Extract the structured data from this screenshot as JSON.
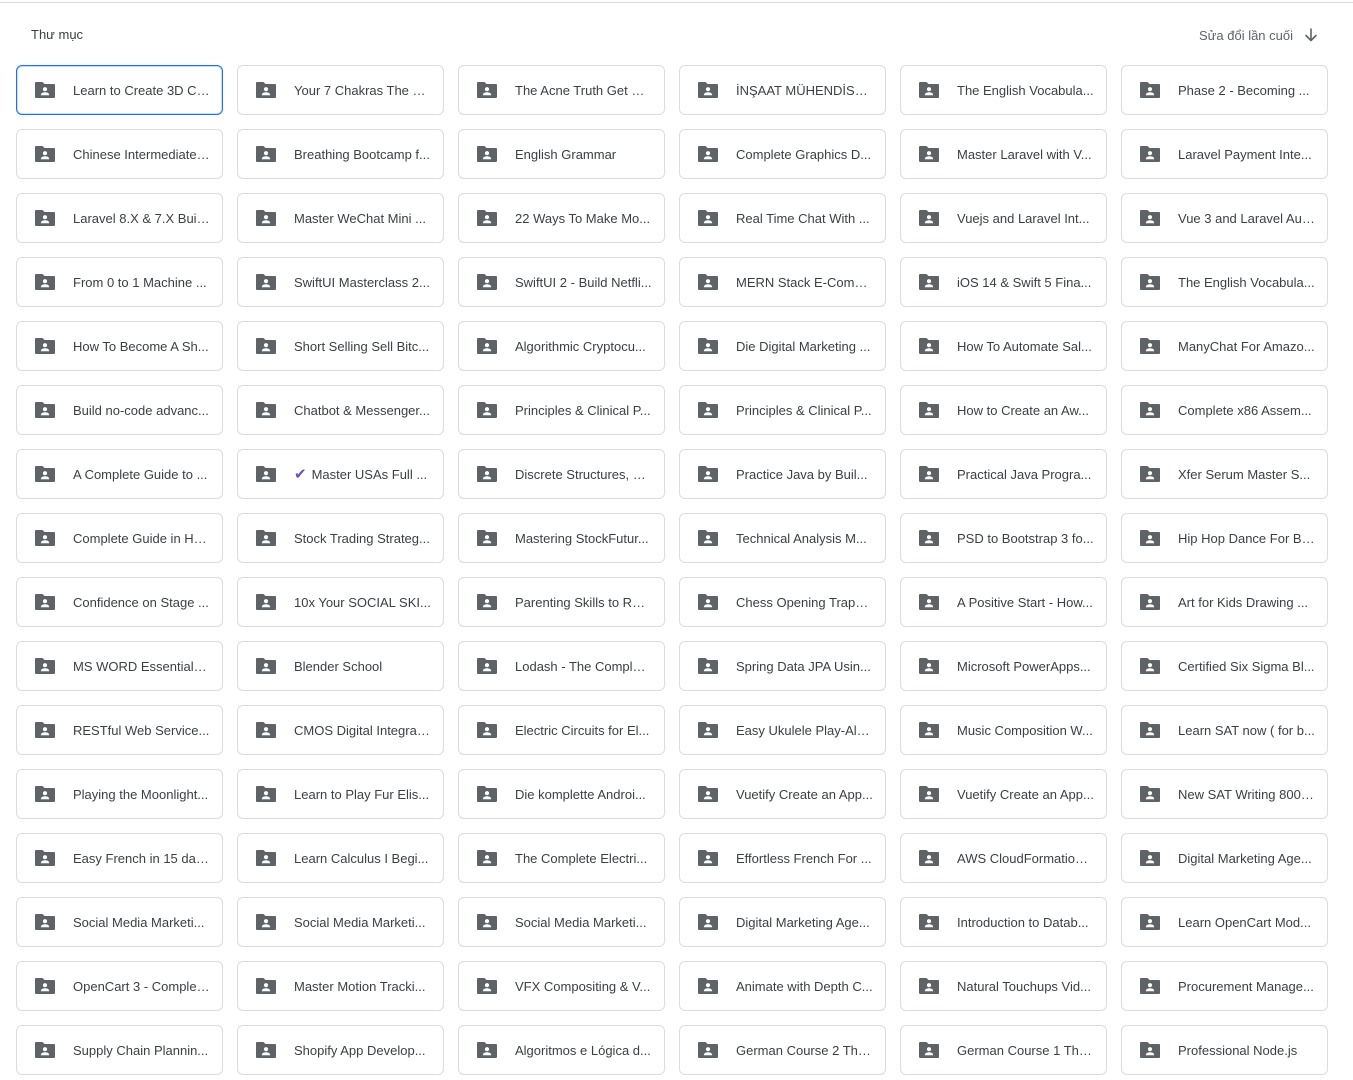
{
  "header": {
    "section_title": "Thư mục",
    "sort_label": "Sửa đổi lần cuối",
    "sort_icon": "arrow-down-icon"
  },
  "folder_icon": "shared-folder-icon",
  "folders": [
    {
      "name": "Learn to Create 3D Ch...",
      "selected": true
    },
    {
      "name": "Your 7 Chakras The C..."
    },
    {
      "name": "The Acne Truth Get Cl..."
    },
    {
      "name": "İNŞAAT MÜHENDİSLİ..."
    },
    {
      "name": "The English Vocabula..."
    },
    {
      "name": "Phase 2 - Becoming ..."
    },
    {
      "name": "Chinese Intermediate ..."
    },
    {
      "name": "Breathing Bootcamp f..."
    },
    {
      "name": "English Grammar"
    },
    {
      "name": "Complete Graphics D..."
    },
    {
      "name": "Master Laravel with V..."
    },
    {
      "name": "Laravel Payment Inte..."
    },
    {
      "name": "Laravel 8.X & 7.X Buil..."
    },
    {
      "name": "Master WeChat Mini ..."
    },
    {
      "name": "22 Ways To Make Mo..."
    },
    {
      "name": "Real Time Chat With ..."
    },
    {
      "name": "Vuejs and Laravel Int..."
    },
    {
      "name": "Vue 3 and Laravel Aut..."
    },
    {
      "name": "From 0 to 1 Machine ..."
    },
    {
      "name": "SwiftUI Masterclass 2..."
    },
    {
      "name": "SwiftUI 2 - Build Netfli..."
    },
    {
      "name": "MERN Stack E-Comm..."
    },
    {
      "name": "iOS 14 & Swift 5 Fina..."
    },
    {
      "name": "The English Vocabula..."
    },
    {
      "name": "How To Become A Sh..."
    },
    {
      "name": "Short Selling Sell Bitc..."
    },
    {
      "name": "Algorithmic Cryptocu..."
    },
    {
      "name": "Die Digital Marketing ..."
    },
    {
      "name": "How To Automate Sal..."
    },
    {
      "name": "ManyChat For Amazo..."
    },
    {
      "name": "Build no-code advanc..."
    },
    {
      "name": "Chatbot & Messenger..."
    },
    {
      "name": "Principles & Clinical P..."
    },
    {
      "name": "Principles & Clinical P..."
    },
    {
      "name": "How to Create an Aw..."
    },
    {
      "name": "Complete x86 Assem..."
    },
    {
      "name": "A Complete Guide to ..."
    },
    {
      "name": "Master USAs Full ...",
      "check": "✔"
    },
    {
      "name": "Discrete Structures, D..."
    },
    {
      "name": "Practice Java by Buil..."
    },
    {
      "name": "Practical Java Progra..."
    },
    {
      "name": "Xfer Serum Master S..."
    },
    {
      "name": "Complete Guide in HT..."
    },
    {
      "name": "Stock Trading Strateg..."
    },
    {
      "name": "Mastering StockFutur..."
    },
    {
      "name": "Technical Analysis M..."
    },
    {
      "name": "PSD to Bootstrap 3 fo..."
    },
    {
      "name": "Hip Hop Dance For Be..."
    },
    {
      "name": "Confidence on Stage ..."
    },
    {
      "name": "10x Your SOCIAL SKI..."
    },
    {
      "name": "Parenting Skills to Rai..."
    },
    {
      "name": "Chess Opening Traps ..."
    },
    {
      "name": "A Positive Start - How..."
    },
    {
      "name": "Art for Kids Drawing ..."
    },
    {
      "name": "MS WORD Essentials ..."
    },
    {
      "name": "Blender School"
    },
    {
      "name": "Lodash - The Complet..."
    },
    {
      "name": "Spring Data JPA Usin..."
    },
    {
      "name": "Microsoft PowerApps..."
    },
    {
      "name": "Certified Six Sigma Bl..."
    },
    {
      "name": "RESTful Web Service..."
    },
    {
      "name": "CMOS Digital Integrat..."
    },
    {
      "name": "Electric Circuits for El..."
    },
    {
      "name": "Easy Ukulele Play-Alo..."
    },
    {
      "name": "Music Composition W..."
    },
    {
      "name": "Learn SAT now ( for b..."
    },
    {
      "name": "Playing the Moonlight..."
    },
    {
      "name": "Learn to Play Fur Elis..."
    },
    {
      "name": "Die komplette Androi..."
    },
    {
      "name": "Vuetify Create an App..."
    },
    {
      "name": "Vuetify Create an App..."
    },
    {
      "name": "New SAT Writing 800 ..."
    },
    {
      "name": "Easy French in 15 day..."
    },
    {
      "name": "Learn Calculus I Begi..."
    },
    {
      "name": "The Complete Electri..."
    },
    {
      "name": "Effortless French For ..."
    },
    {
      "name": "AWS CloudFormation ..."
    },
    {
      "name": "Digital Marketing Age..."
    },
    {
      "name": "Social Media Marketi..."
    },
    {
      "name": "Social Media Marketi..."
    },
    {
      "name": "Social Media Marketi..."
    },
    {
      "name": "Digital Marketing Age..."
    },
    {
      "name": "Introduction to Datab..."
    },
    {
      "name": "Learn OpenCart Mod..."
    },
    {
      "name": "OpenCart 3 - Complet..."
    },
    {
      "name": "Master Motion Tracki..."
    },
    {
      "name": "VFX Compositing & V..."
    },
    {
      "name": "Animate with Depth C..."
    },
    {
      "name": "Natural Touchups Vid..."
    },
    {
      "name": "Procurement Manage..."
    },
    {
      "name": "Supply Chain Plannin..."
    },
    {
      "name": "Shopify App Develop..."
    },
    {
      "name": "Algoritmos e Lógica d..."
    },
    {
      "name": "German Course 2 The..."
    },
    {
      "name": "German Course 1 The..."
    },
    {
      "name": "Professional Node.js"
    }
  ]
}
